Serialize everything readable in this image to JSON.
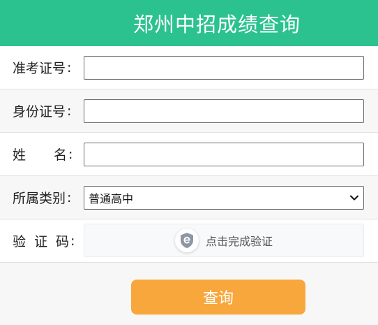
{
  "header": {
    "title": "郑州中招成绩查询"
  },
  "form": {
    "exam_id_label": "准考证号",
    "id_card_label": "身份证号",
    "name_label_char1": "姓",
    "name_label_char2": "名",
    "category_label": "所属类别",
    "category_selected": "普通高中",
    "captcha_label_char1": "验",
    "captcha_label_char2": "证",
    "captcha_label_char3": "码",
    "captcha_text": "点击完成验证",
    "colon": ":"
  },
  "actions": {
    "submit_label": "查询"
  },
  "colors": {
    "header_bg": "#2bc28f",
    "button_bg": "#f8a73c",
    "page_bg": "#f7f7f7"
  },
  "icons": {
    "select": "chevron-down-icon",
    "captcha": "shield-e-icon"
  }
}
